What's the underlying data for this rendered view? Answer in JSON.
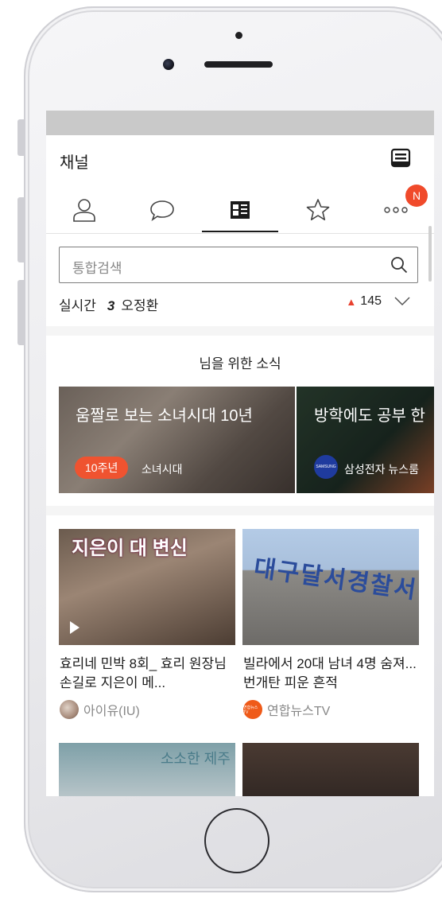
{
  "header": {
    "title": "채널"
  },
  "tabs": {
    "badge": "N"
  },
  "search": {
    "placeholder": "통합검색"
  },
  "trending": {
    "label": "실시간",
    "rank": "3",
    "keyword": "오정환",
    "count": "145"
  },
  "news": {
    "heading": "님을 위한 소식",
    "cards": [
      {
        "title": "움짤로 보는 소녀시대 10년",
        "tag": "10주년",
        "source": "소녀시대"
      },
      {
        "title": "방학에도 공부 한",
        "logo_text": "SAMSUNG",
        "source": "삼성전자 뉴스룸"
      }
    ]
  },
  "videos": [
    {
      "overlay": "지은이 대 변신",
      "title": "효리네 민박 8회_ 효리 원장님 손길로 지은이 메...",
      "channel": "아이유(IU)"
    },
    {
      "overlay": "대구달서경찰서",
      "title": "빌라에서 20대 남녀 4명 숨져...번개탄 피운 흔적",
      "channel": "연합뉴스TV",
      "channel_logo": "연합뉴스TV"
    },
    {
      "overlay": "소소한 제주"
    },
    {
      "overlay": ""
    }
  ],
  "colors": {
    "accent": "#f04a2b",
    "up_arrow": "#e8412f",
    "tag": "#ef5330"
  },
  "icons": [
    "inbox-icon",
    "person-icon",
    "chat-icon",
    "channel-icon",
    "star-icon",
    "more-icon",
    "search-icon",
    "chevron-down-icon",
    "up-arrow-icon",
    "play-icon"
  ]
}
